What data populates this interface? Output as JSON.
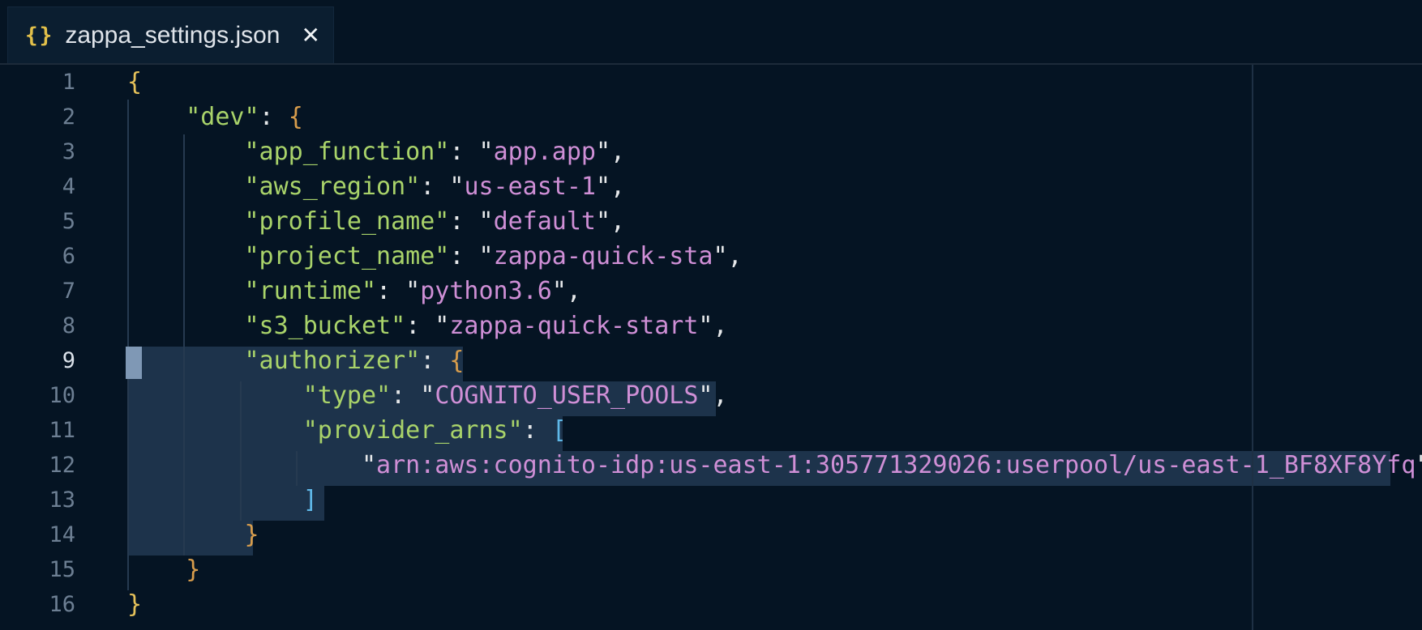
{
  "tab": {
    "icon": "{}",
    "filename": "zappa_settings.json",
    "close_glyph": "✕"
  },
  "editor": {
    "active_line": 9,
    "lines": [
      {
        "n": "1",
        "tokens": [
          {
            "t": "{",
            "c": "b"
          }
        ]
      },
      {
        "n": "2",
        "tokens": [
          {
            "t": "    ",
            "c": "p"
          },
          {
            "t": "\"dev\"",
            "c": "k"
          },
          {
            "t": ": ",
            "c": "p"
          },
          {
            "t": "{",
            "c": "bo"
          }
        ]
      },
      {
        "n": "3",
        "tokens": [
          {
            "t": "        ",
            "c": "p"
          },
          {
            "t": "\"app_function\"",
            "c": "k"
          },
          {
            "t": ": \"",
            "c": "p"
          },
          {
            "t": "app.app",
            "c": "s"
          },
          {
            "t": "\",",
            "c": "p"
          }
        ]
      },
      {
        "n": "4",
        "tokens": [
          {
            "t": "        ",
            "c": "p"
          },
          {
            "t": "\"aws_region\"",
            "c": "k"
          },
          {
            "t": ": \"",
            "c": "p"
          },
          {
            "t": "us-east-1",
            "c": "s"
          },
          {
            "t": "\",",
            "c": "p"
          }
        ]
      },
      {
        "n": "5",
        "tokens": [
          {
            "t": "        ",
            "c": "p"
          },
          {
            "t": "\"profile_name\"",
            "c": "k"
          },
          {
            "t": ": \"",
            "c": "p"
          },
          {
            "t": "default",
            "c": "s"
          },
          {
            "t": "\",",
            "c": "p"
          }
        ]
      },
      {
        "n": "6",
        "tokens": [
          {
            "t": "        ",
            "c": "p"
          },
          {
            "t": "\"project_name\"",
            "c": "k"
          },
          {
            "t": ": \"",
            "c": "p"
          },
          {
            "t": "zappa-quick-sta",
            "c": "s"
          },
          {
            "t": "\",",
            "c": "p"
          }
        ]
      },
      {
        "n": "7",
        "tokens": [
          {
            "t": "        ",
            "c": "p"
          },
          {
            "t": "\"runtime\"",
            "c": "k"
          },
          {
            "t": ": \"",
            "c": "p"
          },
          {
            "t": "python3.6",
            "c": "s"
          },
          {
            "t": "\",",
            "c": "p"
          }
        ]
      },
      {
        "n": "8",
        "tokens": [
          {
            "t": "        ",
            "c": "p"
          },
          {
            "t": "\"s3_bucket\"",
            "c": "k"
          },
          {
            "t": ": \"",
            "c": "p"
          },
          {
            "t": "zappa-quick-start",
            "c": "s"
          },
          {
            "t": "\",",
            "c": "p"
          }
        ]
      },
      {
        "n": "9",
        "tokens": [
          {
            "t": "        ",
            "c": "p"
          },
          {
            "t": "\"authorizer\"",
            "c": "k"
          },
          {
            "t": ": ",
            "c": "p"
          },
          {
            "t": "{",
            "c": "bo"
          }
        ]
      },
      {
        "n": "10",
        "tokens": [
          {
            "t": "            ",
            "c": "p"
          },
          {
            "t": "\"type\"",
            "c": "k"
          },
          {
            "t": ": \"",
            "c": "p"
          },
          {
            "t": "COGNITO_USER_POOLS",
            "c": "s"
          },
          {
            "t": "\",",
            "c": "p"
          }
        ]
      },
      {
        "n": "11",
        "tokens": [
          {
            "t": "            ",
            "c": "p"
          },
          {
            "t": "\"provider_arns\"",
            "c": "k"
          },
          {
            "t": ": ",
            "c": "p"
          },
          {
            "t": "[",
            "c": "bb"
          }
        ]
      },
      {
        "n": "12",
        "tokens": [
          {
            "t": "                \"",
            "c": "p"
          },
          {
            "t": "arn:aws:cognito-idp:us-east-1:305771329026:userpool/us-east-1_BF8XF8Yfq",
            "c": "s"
          },
          {
            "t": "\"",
            "c": "p"
          }
        ]
      },
      {
        "n": "13",
        "tokens": [
          {
            "t": "            ",
            "c": "p"
          },
          {
            "t": "]",
            "c": "bb"
          }
        ]
      },
      {
        "n": "14",
        "tokens": [
          {
            "t": "        ",
            "c": "p"
          },
          {
            "t": "}",
            "c": "bo"
          }
        ]
      },
      {
        "n": "15",
        "tokens": [
          {
            "t": "    ",
            "c": "p"
          },
          {
            "t": "}",
            "c": "bo"
          }
        ]
      },
      {
        "n": "16",
        "tokens": [
          {
            "t": "}",
            "c": "b"
          }
        ]
      }
    ]
  }
}
